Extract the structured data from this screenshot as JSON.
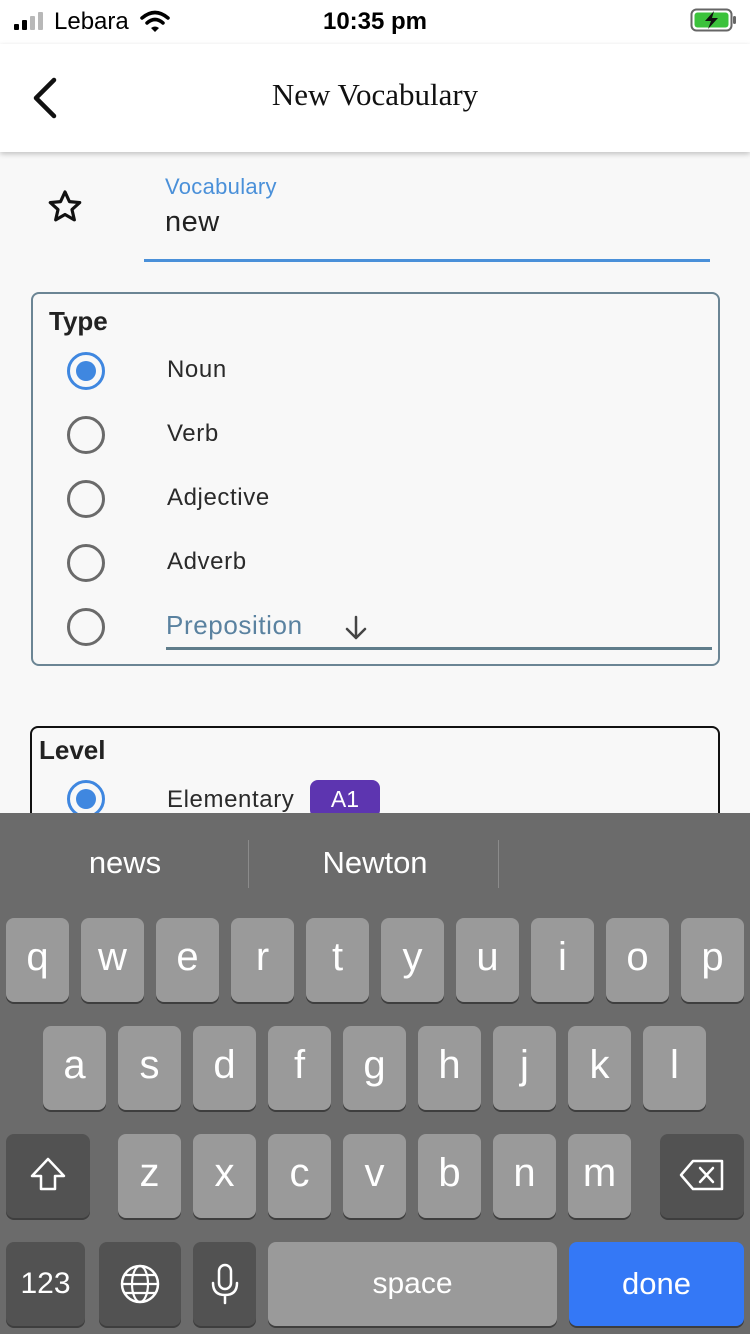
{
  "status_bar": {
    "carrier": "Lebara",
    "time": "10:35 pm",
    "battery_color": "#3cc23c"
  },
  "nav": {
    "title": "New Vocabulary",
    "back_icon": "chevron-left-icon"
  },
  "form": {
    "favorite_icon": "star-outline-icon",
    "vocabulary": {
      "label": "Vocabulary",
      "value": "new",
      "accent_color": "#4a90d9"
    },
    "type": {
      "title": "Type",
      "options": [
        {
          "label": "Noun",
          "selected": true
        },
        {
          "label": "Verb",
          "selected": false
        },
        {
          "label": "Adjective",
          "selected": false
        },
        {
          "label": "Adverb",
          "selected": false
        }
      ],
      "dropdown": {
        "label": "Preposition",
        "icon": "arrow-down-icon"
      }
    },
    "level": {
      "title": "Level",
      "options": [
        {
          "label": "Elementary",
          "badge": "A1",
          "badge_color": "#5d35b0",
          "selected": true
        }
      ]
    }
  },
  "keyboard": {
    "suggestions": [
      "news",
      "Newton",
      ""
    ],
    "row1": [
      "q",
      "w",
      "e",
      "r",
      "t",
      "y",
      "u",
      "i",
      "o",
      "p"
    ],
    "row2": [
      "a",
      "s",
      "d",
      "f",
      "g",
      "h",
      "j",
      "k",
      "l"
    ],
    "row3": [
      "z",
      "x",
      "c",
      "v",
      "b",
      "n",
      "m"
    ],
    "numbers_label": "123",
    "space_label": "space",
    "done_label": "done",
    "done_color": "#3478f6"
  }
}
